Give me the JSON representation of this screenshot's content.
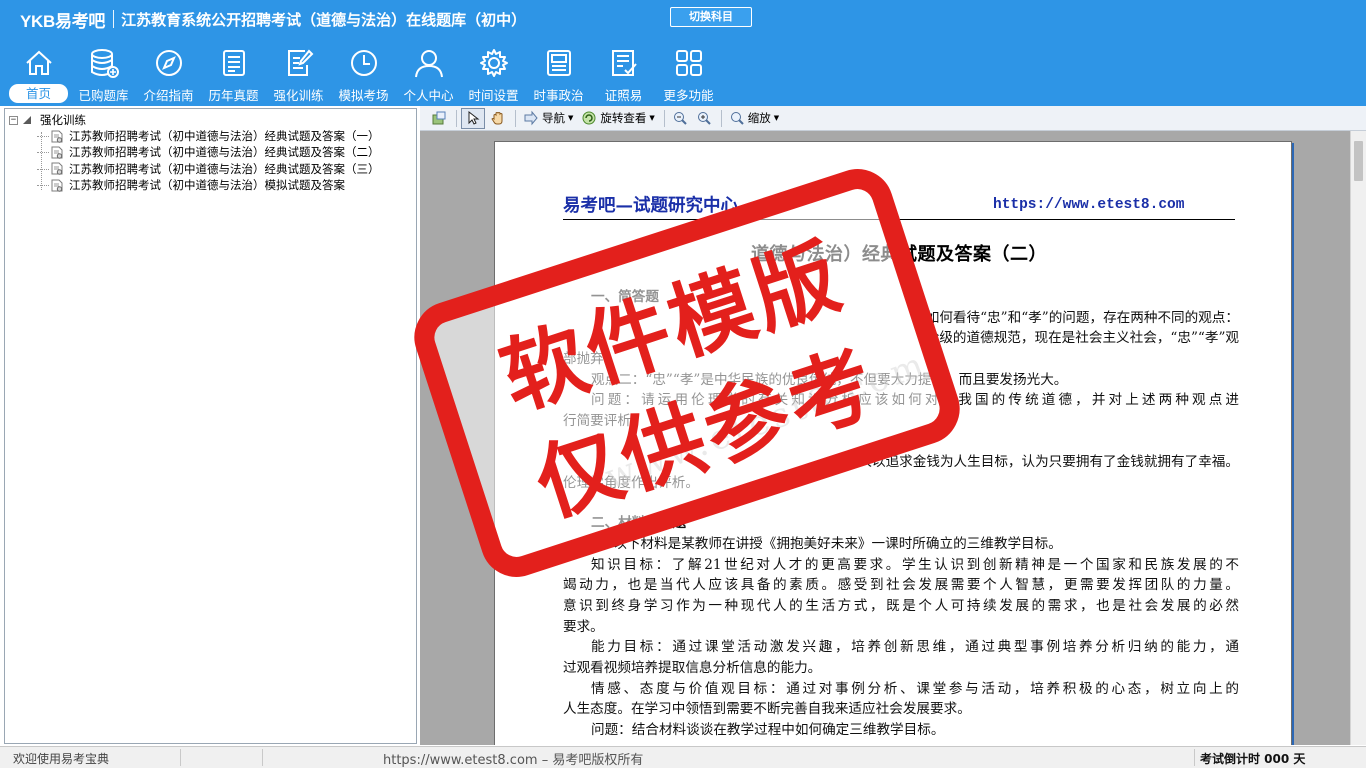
{
  "app": {
    "logo": "YKB易考吧",
    "title": "江苏教育系统公开招聘考试（道德与法治）在线题库（初中）",
    "switch_subject": "切换科目"
  },
  "nav": [
    {
      "label": "首页",
      "icon": "home-icon"
    },
    {
      "label": "已购题库",
      "icon": "database-icon"
    },
    {
      "label": "介绍指南",
      "icon": "compass-icon"
    },
    {
      "label": "历年真题",
      "icon": "document-list-icon"
    },
    {
      "label": "强化训练",
      "icon": "edit-document-icon"
    },
    {
      "label": "模拟考场",
      "icon": "clock-icon"
    },
    {
      "label": "个人中心",
      "icon": "user-icon"
    },
    {
      "label": "时间设置",
      "icon": "gear-icon"
    },
    {
      "label": "时事政治",
      "icon": "newspaper-icon"
    },
    {
      "label": "证照易",
      "icon": "checklist-icon"
    },
    {
      "label": "更多功能",
      "icon": "grid-icon"
    }
  ],
  "tree": {
    "root": "强化训练",
    "items": [
      "江苏教师招聘考试（初中道德与法治）经典试题及答案（一）",
      "江苏教师招聘考试（初中道德与法治）经典试题及答案（二）",
      "江苏教师招聘考试（初中道德与法治）经典试题及答案（三）",
      "江苏教师招聘考试（初中道德与法治）模拟试题及答案"
    ]
  },
  "toolbar": {
    "navigate": "导航",
    "rotate": "旋转查看",
    "zoom": "缩放"
  },
  "document": {
    "header_left": "易考吧—试题研究中心",
    "header_right": "https://www.etest8.com",
    "title": "道德与法治）经典试题及答案（二）",
    "lines": [
      {
        "text": "一、简答题",
        "style": "indent bold"
      },
      {
        "text": "于如何看待“忠”和“孝”的问题，存在两种不同的观点：",
        "style": "indent right"
      },
      {
        "text": "阶级的道德规范，现在是社会主义社会，“忠”“孝”观",
        "style": "right"
      },
      {
        "text": "部抛弃。",
        "style": ""
      },
      {
        "text": "观点二：“忠”“孝”是中华民族的优良传统，不但要大力提倡，而且要发扬光大。",
        "style": "indent"
      },
      {
        "text": "问题：请运用伦理学的有关知识分析应该如何对待我国的传统道德，并对上述两种观点进",
        "style": "indent justify"
      },
      {
        "text": "行简要评析。",
        "style": ""
      },
      {
        "text": "",
        "style": "gap"
      },
      {
        "text": "2.有人以追求金钱为人生目标，认为只要拥有了金钱就拥有了幸福。",
        "style": "right"
      },
      {
        "text": "伦理学角度作出评析。",
        "style": ""
      },
      {
        "text": "",
        "style": "gap"
      },
      {
        "text": "二、材料分析题",
        "style": "indent bold"
      },
      {
        "text": "1．以下材料是某教师在讲授《拥抱美好未来》一课时所确立的三维教学目标。",
        "style": "indent"
      },
      {
        "text": "知识目标：了解21世纪对人才的更高要求。学生认识到创新精神是一个国家和民族发展的不",
        "style": "indent justify"
      },
      {
        "text": "竭动力，也是当代人应该具备的素质。感受到社会发展需要个人智慧，更需要发挥团队的力量。",
        "style": "justify"
      },
      {
        "text": "意识到终身学习作为一种现代人的生活方式，既是个人可持续发展的需求，也是社会发展的必然",
        "style": "justify"
      },
      {
        "text": "要求。",
        "style": ""
      },
      {
        "text": "能力目标：通过课堂活动激发兴趣，培养创新思维，通过典型事例培养分析归纳的能力，通",
        "style": "indent justify"
      },
      {
        "text": "过观看视频培养提取信息分析信息的能力。",
        "style": ""
      },
      {
        "text": "情感、态度与价值观目标：通过对事例分析、课堂参与活动，培养积极的心态，树立向上的",
        "style": "indent justify"
      },
      {
        "text": "人生态度。在学习中领悟到需要不断完善自我来适应社会发展要求。",
        "style": ""
      },
      {
        "text": "问题：结合材料谈谈在教学过程中如何确定三维教学目标。",
        "style": "indent"
      }
    ]
  },
  "stamp": {
    "line1": "软件模版",
    "line2": "仅供参考",
    "color": "#e3201c"
  },
  "watermark": "www.etest8.com",
  "status": {
    "welcome": "欢迎使用易考宝典",
    "copyright": "https://www.etest8.com – 易考吧版权所有",
    "exam_countdown": "考试倒计时 000 天"
  },
  "colors": {
    "header_bg": "#2e95e6",
    "link_blue": "#1a2fa8"
  }
}
